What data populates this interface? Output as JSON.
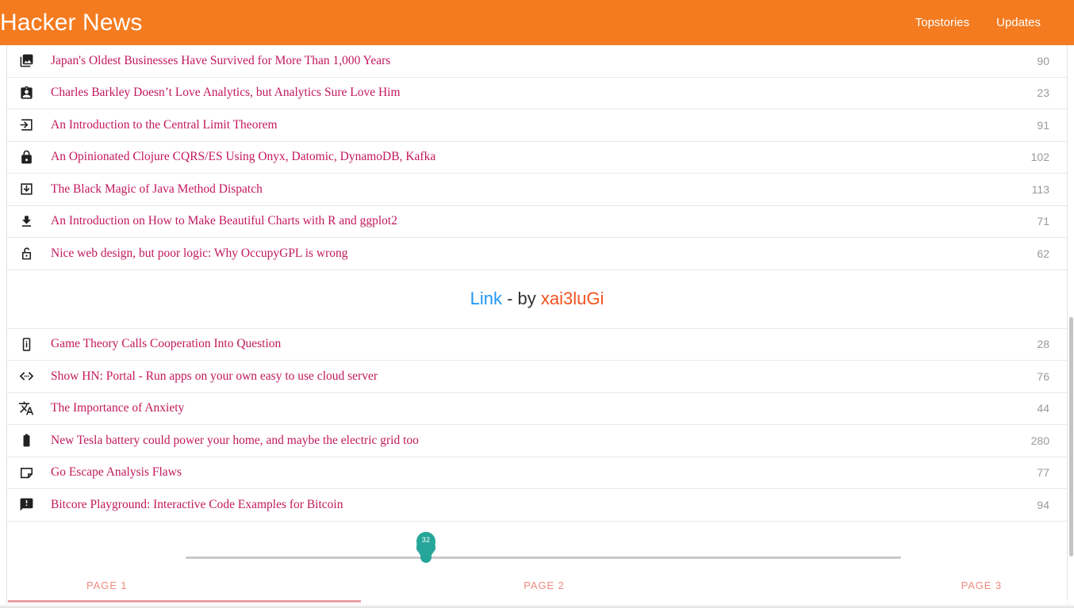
{
  "toolbar": {
    "brand": "Hacker News",
    "nav": [
      {
        "label": "Topstories",
        "name": "nav-link-topstories"
      },
      {
        "label": "Updates",
        "name": "nav-link-updates"
      }
    ],
    "background_color": "#f47b20",
    "text_color": "#ffffff"
  },
  "stories_top": [
    {
      "icon": "photo-library-icon",
      "title": "Japan's Oldest Businesses Have Survived for More Than 1,000 Years",
      "score": "90"
    },
    {
      "icon": "contact-card-icon",
      "title": "Charles Barkley Doesn’t Love Analytics, but Analytics Sure Love Him",
      "score": "23"
    },
    {
      "icon": "login-arrow-icon",
      "title": "An Introduction to the Central Limit Theorem",
      "score": "91"
    },
    {
      "icon": "lock-closed-icon",
      "title": "An Opinionated Clojure CQRS/ES Using Onyx, Datomic, DynamoDB, Kafka",
      "score": "102"
    },
    {
      "icon": "save-alt-icon",
      "title": "The Black Magic of Java Method Dispatch",
      "score": "113"
    },
    {
      "icon": "download-icon",
      "title": "An Introduction on How to Make Beautiful Charts with R and ggplot2",
      "score": "71"
    },
    {
      "icon": "lock-open-icon",
      "title": "Nice web design, but poor logic: Why OccupyGPL is wrong",
      "score": "62"
    }
  ],
  "promo": {
    "link_label": "Link",
    "separator": " - by ",
    "author": "xai3luGi",
    "link_color": "#2196f3",
    "author_color": "#f4511e"
  },
  "stories_bottom": [
    {
      "icon": "phone-info-icon",
      "title": "Game Theory Calls Cooperation Into Question",
      "score": "28"
    },
    {
      "icon": "code-brackets-icon",
      "title": "Show HN: Portal - Run apps on your own easy to use cloud server",
      "score": "76"
    },
    {
      "icon": "translate-icon",
      "title": "The Importance of Anxiety",
      "score": "44"
    },
    {
      "icon": "battery-icon",
      "title": "New Tesla battery could power your home, and maybe the electric grid too",
      "score": "280"
    },
    {
      "icon": "note-page-icon",
      "title": "Go Escape Analysis Flaws",
      "score": "77"
    },
    {
      "icon": "announcement-icon",
      "title": "Bitcore Playground: Interactive Code Examples for Bitcoin",
      "score": "94"
    }
  ],
  "footer": {
    "slider": {
      "value": "32",
      "thumb_color": "#26a69a",
      "track_color": "#c9c9c9"
    },
    "pages": [
      {
        "label": "PAGE 1",
        "name": "page-tab-1"
      },
      {
        "label": "PAGE 2",
        "name": "page-tab-2"
      },
      {
        "label": "PAGE 3",
        "name": "page-tab-3"
      }
    ],
    "page_label_color": "#ef8a80",
    "progress_color": "#e8a0a5"
  }
}
